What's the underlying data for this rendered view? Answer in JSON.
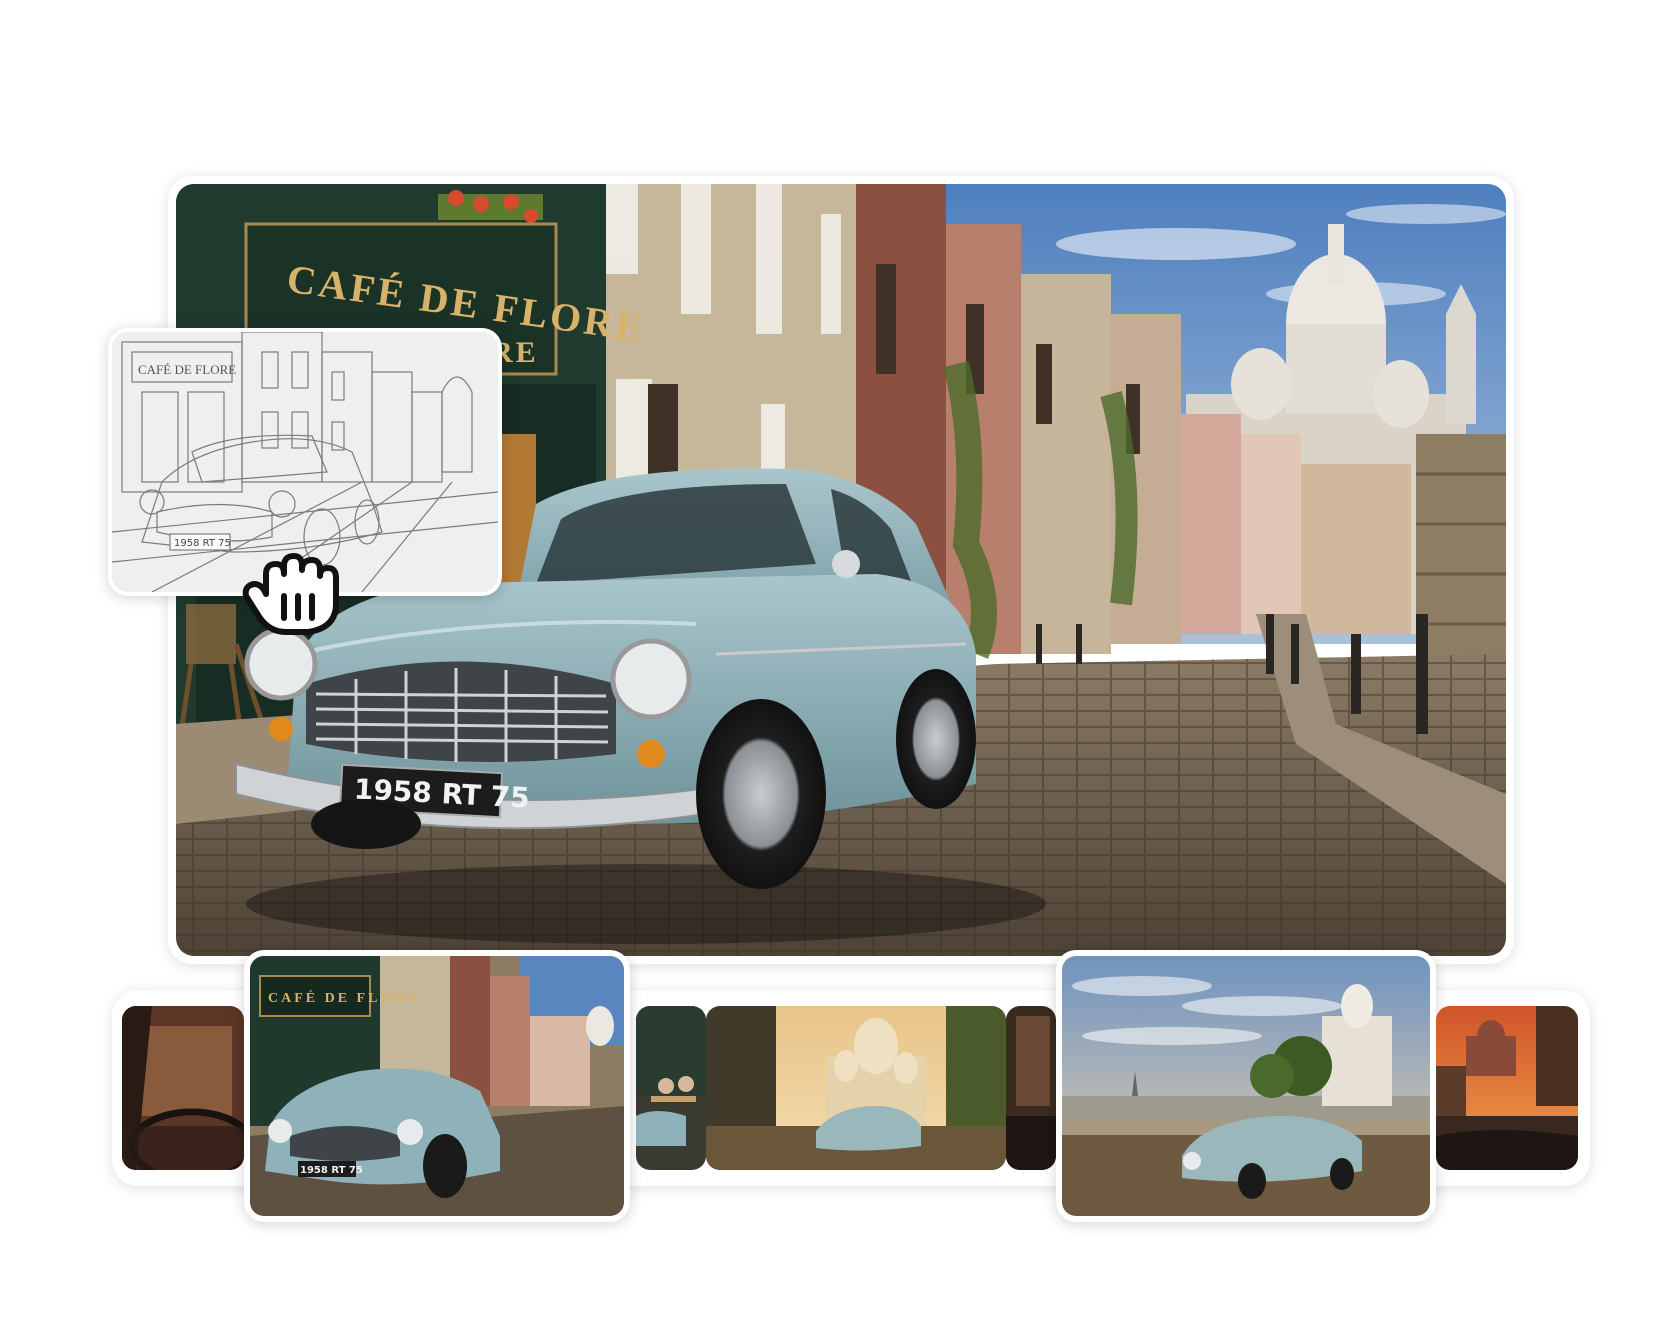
{
  "main_image": {
    "cafe_sign": "CAFÉ DE FLORE",
    "cafe_sign_suffix": "RE",
    "license_plate": "1958 RT 75"
  },
  "sketch_overlay": {
    "cafe_sign": "CAFÉ DE FLORE",
    "license_plate": "1958 RT 75"
  },
  "grab_cursor": {
    "icon": "grab-hand-icon"
  },
  "thumbnails": [
    {
      "id": "car-interior-dusk",
      "selected": false
    },
    {
      "id": "montmartre-street",
      "selected": true,
      "cafe_sign": "CAFÉ DE FLORE",
      "license_plate": "1958 RT 75"
    },
    {
      "id": "cafe-terrace",
      "selected": false
    },
    {
      "id": "sacre-coeur-golden",
      "selected": false
    },
    {
      "id": "car-interior-night",
      "selected": false
    },
    {
      "id": "paris-overlook",
      "selected": true
    },
    {
      "id": "sunset-street",
      "selected": false
    }
  ],
  "colors": {
    "car_body": "#8fb1b9",
    "sky": "#5a86c0",
    "cafe_green": "#1f3a2d",
    "sign_gold": "#d7b26a"
  }
}
